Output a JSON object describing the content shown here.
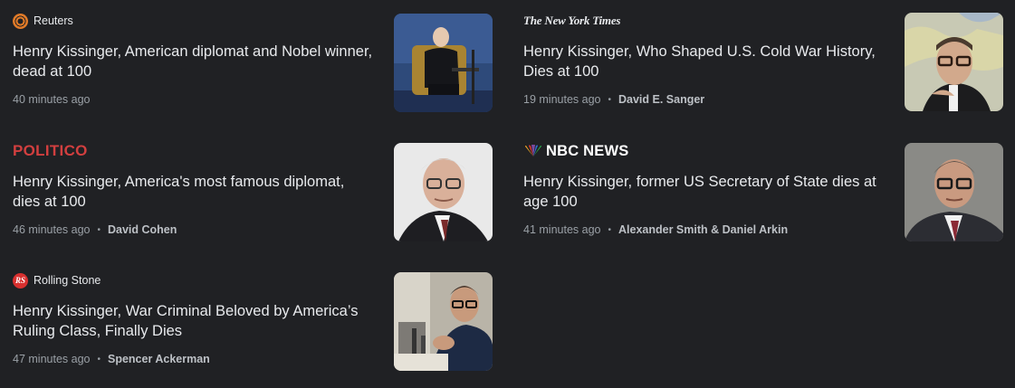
{
  "articles": [
    {
      "source": "Reuters",
      "source_icon": "reuters-logo-icon",
      "headline": "Henry Kissinger, American diplomat and Nobel winner, dead at 100",
      "time": "40 minutes ago",
      "author": "",
      "thumbnail": "kissinger-seated-on-stage-photo"
    },
    {
      "source": "The New York Times",
      "source_icon": "nyt-logo",
      "headline": "Henry Kissinger, Who Shaped U.S. Cold War History, Dies at 100",
      "time": "19 minutes ago",
      "author": "David E. Sanger",
      "thumbnail": "kissinger-portrait-world-map-photo"
    },
    {
      "source": "POLITICO",
      "source_icon": "politico-logo",
      "headline": "Henry Kissinger, America's most famous diplomat, dies at 100",
      "time": "46 minutes ago",
      "author": "David Cohen",
      "thumbnail": "kissinger-elderly-portrait-photo"
    },
    {
      "source": "NBC NEWS",
      "source_icon": "nbc-peacock-icon",
      "headline": "Henry Kissinger, former US Secretary of State dies at age 100",
      "time": "41 minutes ago",
      "author": "Alexander Smith & Daniel Arkin",
      "thumbnail": "kissinger-official-portrait-photo"
    },
    {
      "source": "Rolling Stone",
      "source_icon": "rolling-stone-icon",
      "rs_initials": "RS",
      "headline": "Henry Kissinger, War Criminal Beloved by America’s Ruling Class, Finally Dies",
      "time": "47 minutes ago",
      "author": "Spencer Ackerman",
      "thumbnail": "kissinger-press-conference-photo"
    }
  ],
  "separator": "•",
  "colors": {
    "background": "#202124",
    "headline": "#e8eaed",
    "meta": "#9aa0a6",
    "politico_red": "#d23f3f",
    "reuters_orange": "#e07a28",
    "rolling_stone_red": "#d8302f"
  }
}
